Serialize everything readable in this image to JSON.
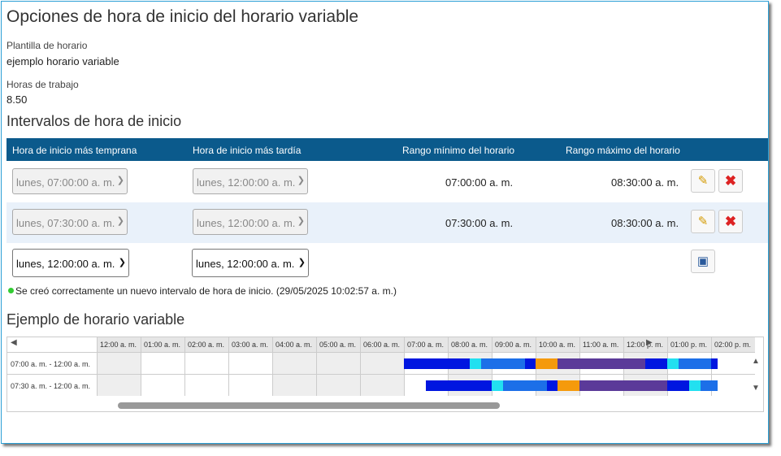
{
  "title": "Opciones de hora de inicio del horario variable",
  "template": {
    "label": "Plantilla de horario",
    "value": "ejemplo horario variable"
  },
  "hours": {
    "label": "Horas de trabajo",
    "value": "8.50"
  },
  "intervals": {
    "title": "Intervalos de hora de inicio",
    "columns": [
      "Hora de inicio más temprana",
      "Hora de inicio más tardía",
      "Rango mínimo del horario",
      "Rango máximo del horario"
    ],
    "rows": [
      {
        "earliest": "lunes, 07:00:00 a. m.",
        "latest": "lunes, 12:00:00 a. m.",
        "min": "07:00:00 a. m.",
        "max": "08:30:00 a. m."
      },
      {
        "earliest": "lunes, 07:30:00 a. m.",
        "latest": "lunes, 12:00:00 a. m.",
        "min": "07:30:00 a. m.",
        "max": "08:30:00 a. m."
      }
    ],
    "new_row": {
      "earliest": "lunes, 12:00:00 a. m.",
      "latest": "lunes, 12:00:00 a. m."
    }
  },
  "status_message": "Se creó correctamente un nuevo intervalo de hora de inicio. (29/05/2025 10:02:57 a. m.)",
  "example": {
    "title": "Ejemplo de horario variable",
    "hours": [
      "12:00 a. m.",
      "01:00 a. m.",
      "02:00 a. m.",
      "03:00 a. m.",
      "04:00 a. m.",
      "05:00 a. m.",
      "06:00 a. m.",
      "07:00 a. m.",
      "08:00 a. m.",
      "09:00 a. m.",
      "10:00 a. m.",
      "11:00 a. m.",
      "12:00 p. m.",
      "01:00 p. m.",
      "02:00 p. m."
    ],
    "rows": [
      "07:00 a. m. - 12:00 a. m.",
      "07:30 a. m. - 12:00 a. m."
    ]
  },
  "colors": {
    "header": "#0b5a8c",
    "accent": "#2a9fd6",
    "blue": "#0016e0",
    "mid_blue": "#1c6fe8",
    "cyan": "#22e0f0",
    "orange": "#f59a0c",
    "purple": "#5b3a99"
  }
}
